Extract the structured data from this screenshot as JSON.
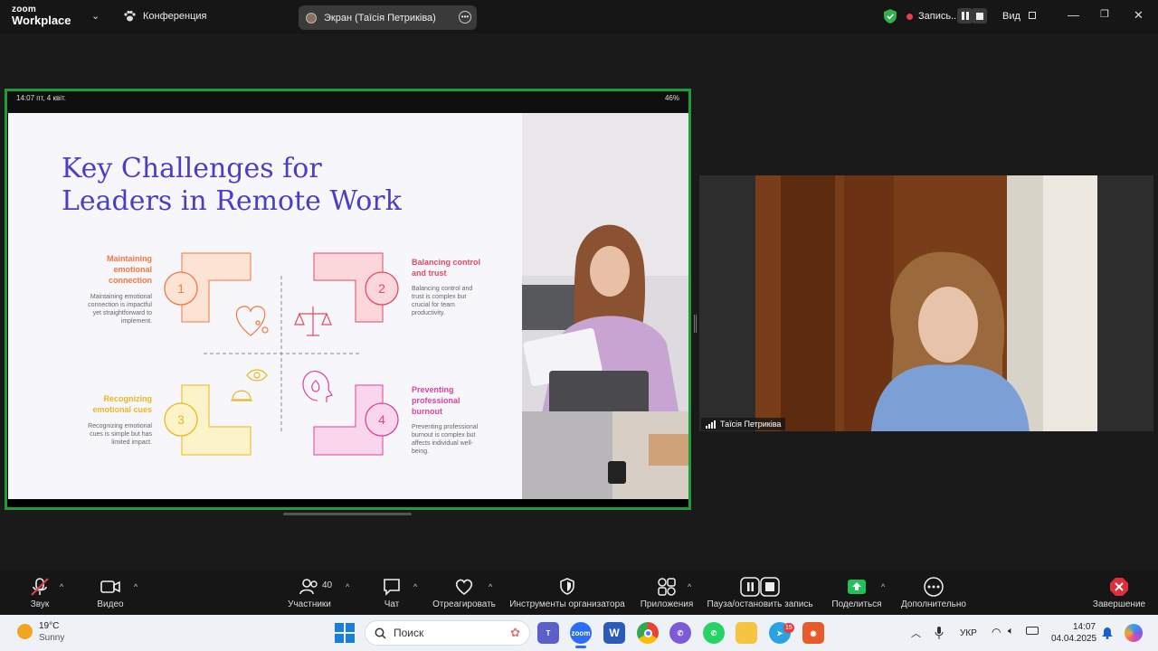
{
  "window": {
    "logo_line1": "zoom",
    "logo_line2": "Workplace",
    "conference_label": "Конференция",
    "screen_share_label": "Экран (Таїсія Петриківа)",
    "recording_label": "Запись...",
    "view_label": "Вид"
  },
  "device_status": {
    "time_date": "14:07  пт, 4 квіт.",
    "battery": "46%"
  },
  "slide": {
    "title_line1": "Key Challenges for",
    "title_line2": "Leaders in Remote Work",
    "quadrants": [
      {
        "number": "1",
        "title_lines": [
          "Maintaining",
          "emotional",
          "connection"
        ],
        "desc_lines": [
          "Maintaining emotional",
          "connection is impactful",
          "yet straightforward to",
          "implement."
        ],
        "color": "#ee7a3f"
      },
      {
        "number": "2",
        "title_lines": [
          "Balancing control",
          "and trust"
        ],
        "desc_lines": [
          "Balancing control and",
          "trust is complex but",
          "crucial for team",
          "productivity."
        ],
        "color": "#e04b63"
      },
      {
        "number": "3",
        "title_lines": [
          "Recognizing",
          "emotional cues"
        ],
        "desc_lines": [
          "Recognizing emotional",
          "cues is simple but has",
          "limited impact."
        ],
        "color": "#e8b81f"
      },
      {
        "number": "4",
        "title_lines": [
          "Preventing",
          "professional",
          "burnout"
        ],
        "desc_lines": [
          "Preventing professional",
          "burnout is complex but",
          "affects individual well-",
          "being."
        ],
        "color": "#d9449b"
      }
    ]
  },
  "participant": {
    "name": "Таїсія Петриківа"
  },
  "toolbar": {
    "audio_label": "Звук",
    "video_label": "Видео",
    "participants_label": "Участники",
    "participants_count": "40",
    "chat_label": "Чат",
    "react_label": "Отреагировать",
    "host_tools_label": "Инструменты организатора",
    "apps_label": "Приложения",
    "pause_record_label": "Пауза/остановить запись",
    "share_label": "Поделиться",
    "more_label": "Дополнительно",
    "end_label": "Завершение"
  },
  "taskbar": {
    "weather_temp": "19°C",
    "weather_desc": "Sunny",
    "search_placeholder": "Поиск",
    "language": "УКР",
    "time": "14:07",
    "date": "04.04.2025",
    "telegram_badge": "15"
  },
  "colors": {
    "accent_green": "#1f9b3a",
    "title_blue": "#4a3fc4",
    "toolbar_bg": "#161616"
  }
}
